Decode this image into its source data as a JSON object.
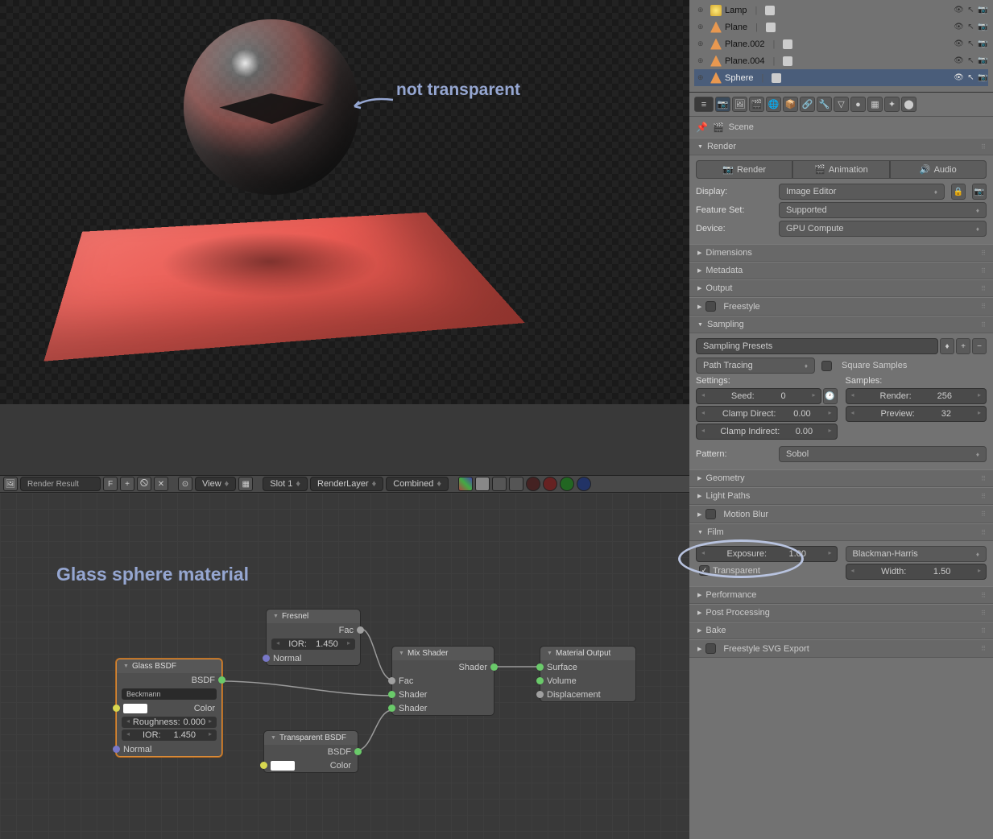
{
  "viewport": {
    "annotation": "not transparent"
  },
  "outliner": {
    "items": [
      {
        "name": "Lamp",
        "type": "lamp"
      },
      {
        "name": "Plane",
        "type": "mesh"
      },
      {
        "name": "Plane.002",
        "type": "mesh"
      },
      {
        "name": "Plane.004",
        "type": "mesh"
      },
      {
        "name": "Sphere",
        "type": "mesh",
        "selected": true
      }
    ]
  },
  "toolbar": {
    "image_name": "Render Result",
    "fake": "F",
    "view": "View",
    "slot": "Slot 1",
    "layer": "RenderLayer",
    "pass": "Combined"
  },
  "node_editor": {
    "title": "Glass sphere material",
    "nodes": {
      "glass": {
        "title": "Glass BSDF",
        "out": "BSDF",
        "dist": "Beckmann",
        "color": "Color",
        "rough_label": "Roughness:",
        "rough": "0.000",
        "ior_label": "IOR:",
        "ior": "1.450",
        "normal": "Normal"
      },
      "fresnel": {
        "title": "Fresnel",
        "out": "Fac",
        "ior_label": "IOR:",
        "ior": "1.450",
        "normal": "Normal"
      },
      "transparent": {
        "title": "Transparent BSDF",
        "out": "BSDF",
        "color": "Color"
      },
      "mix": {
        "title": "Mix Shader",
        "out": "Shader",
        "fac": "Fac",
        "s1": "Shader",
        "s2": "Shader"
      },
      "output": {
        "title": "Material Output",
        "surface": "Surface",
        "volume": "Volume",
        "disp": "Displacement"
      }
    }
  },
  "breadcrumb": {
    "scene": "Scene"
  },
  "panels": {
    "render": {
      "title": "Render",
      "btn_render": "Render",
      "btn_anim": "Animation",
      "btn_audio": "Audio",
      "display_label": "Display:",
      "display": "Image Editor",
      "feature_label": "Feature Set:",
      "feature": "Supported",
      "device_label": "Device:",
      "device": "GPU Compute"
    },
    "dimensions": "Dimensions",
    "metadata": "Metadata",
    "output": "Output",
    "freestyle": "Freestyle",
    "sampling": {
      "title": "Sampling",
      "presets": "Sampling Presets",
      "integrator": "Path Tracing",
      "square": "Square Samples",
      "settings_label": "Settings:",
      "samples_label": "Samples:",
      "seed_label": "Seed:",
      "seed": "0",
      "clamp_d_label": "Clamp Direct:",
      "clamp_d": "0.00",
      "clamp_i_label": "Clamp Indirect:",
      "clamp_i": "0.00",
      "render_label": "Render:",
      "render": "256",
      "preview_label": "Preview:",
      "preview": "32",
      "pattern_label": "Pattern:",
      "pattern": "Sobol"
    },
    "geometry": "Geometry",
    "light_paths": "Light Paths",
    "motion_blur": "Motion Blur",
    "film": {
      "title": "Film",
      "exposure_label": "Exposure:",
      "exposure": "1.00",
      "transparent": "Transparent",
      "filter": "Blackman-Harris",
      "width_label": "Width:",
      "width": "1.50"
    },
    "performance": "Performance",
    "post": "Post Processing",
    "bake": "Bake",
    "svg": "Freestyle SVG Export"
  }
}
